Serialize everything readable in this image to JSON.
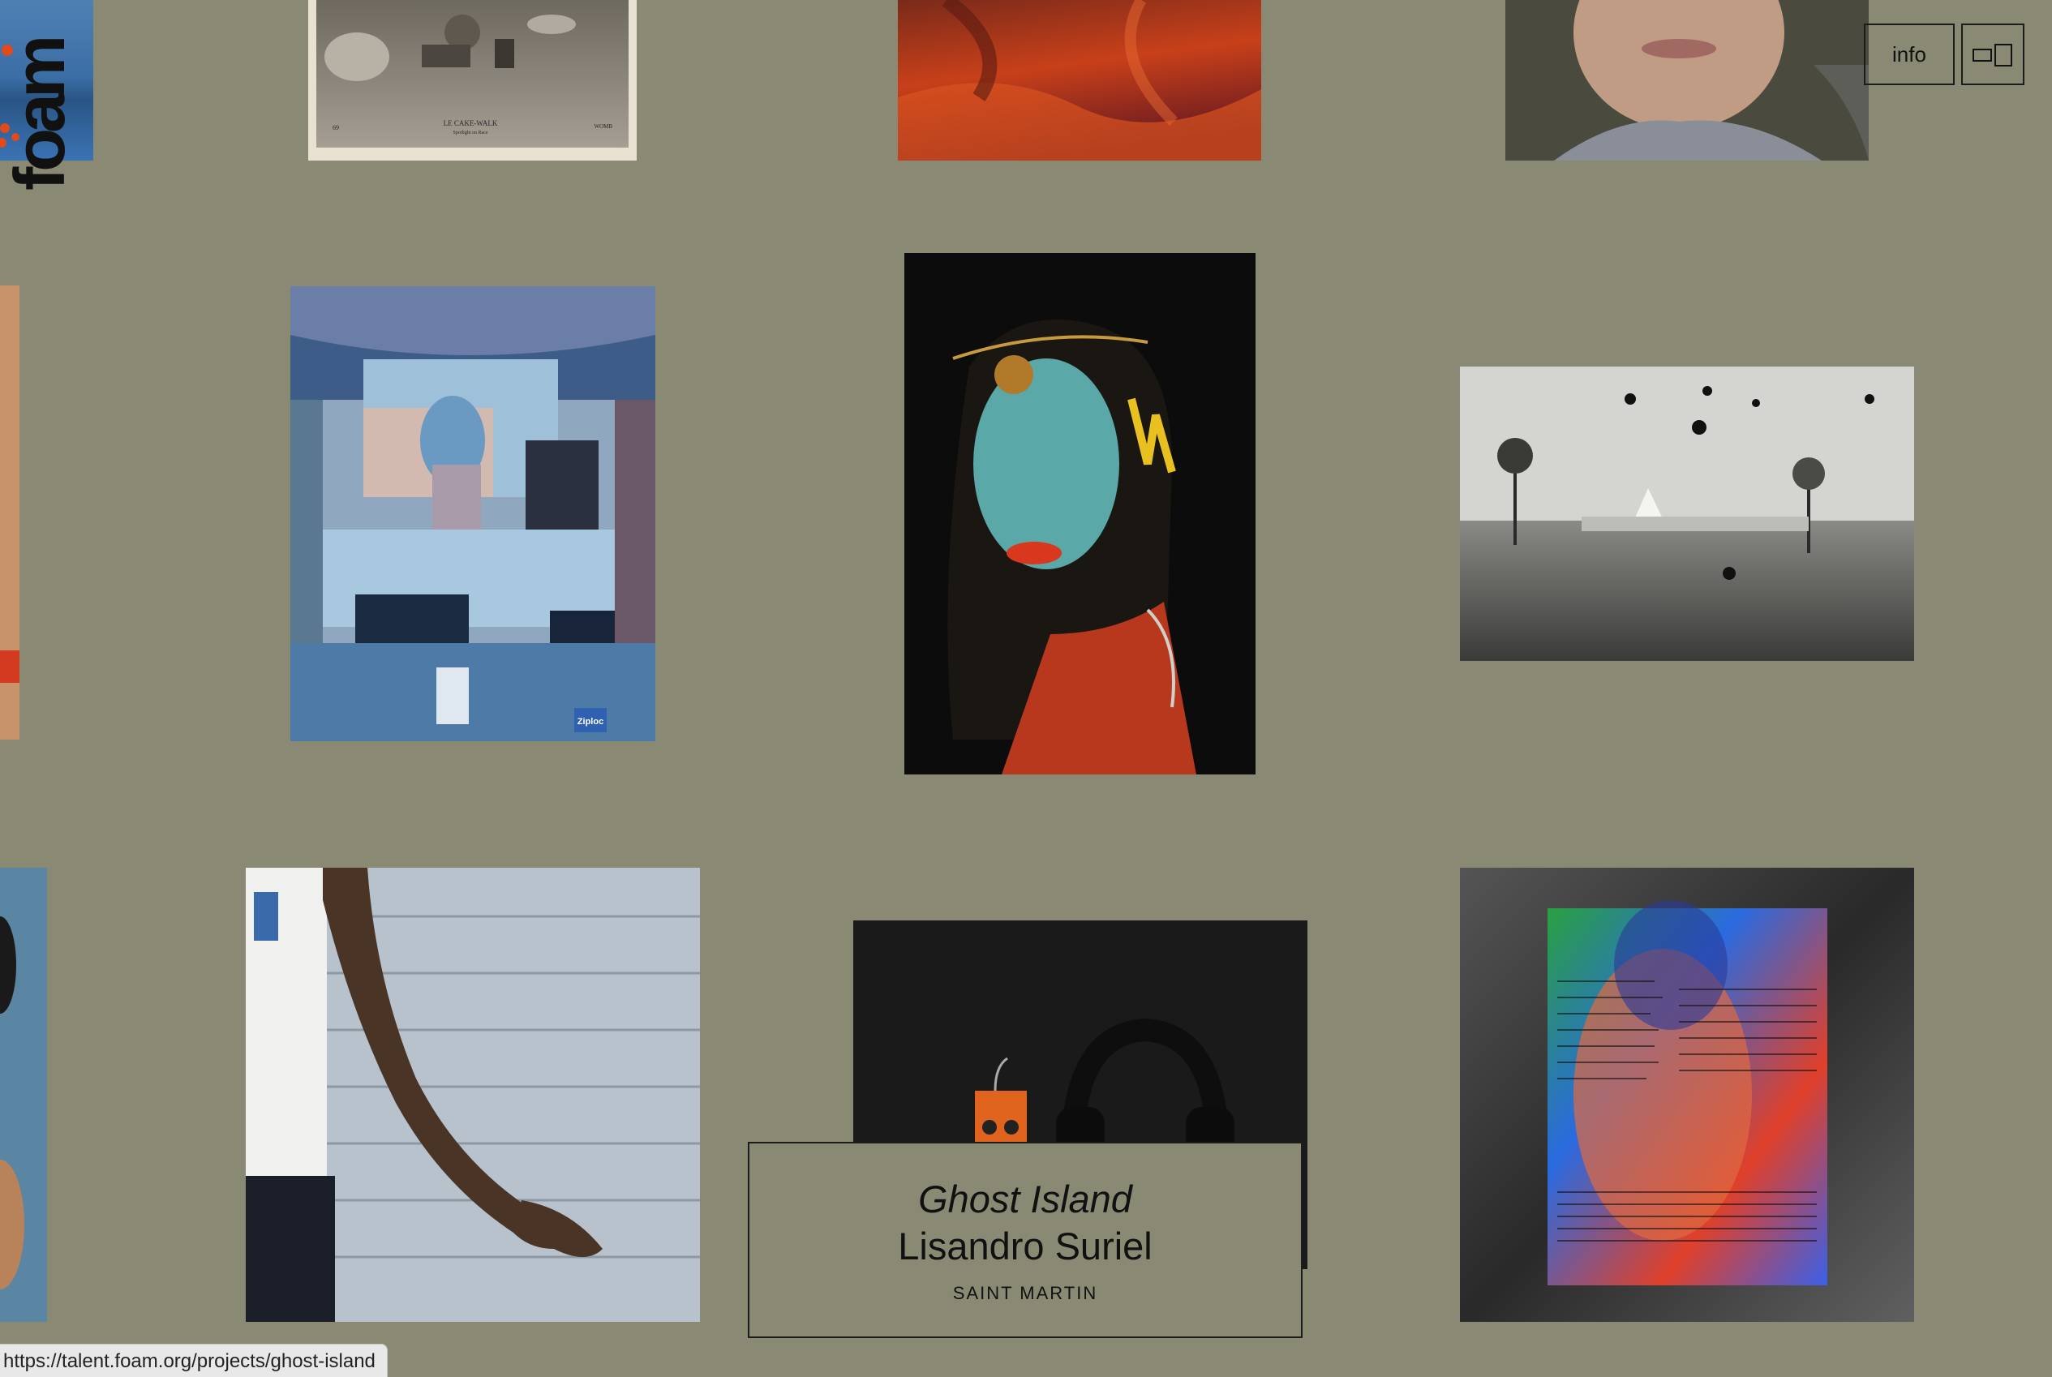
{
  "logo": {
    "text": "foam"
  },
  "controls": {
    "info_label": "info",
    "layout_toggle_icon": "layout-toggle-icon"
  },
  "featured": {
    "title": "Ghost Island",
    "artist": "Lisandro Suriel",
    "location": "SAINT MARTIN"
  },
  "status_bar": {
    "url": "https://talent.foam.org/projects/ghost-island"
  },
  "photos": {
    "cakewalk_poster": {
      "left_text": "69",
      "center_title": "LE CAKE-WALK",
      "center_sub": "Spotlight on Race",
      "right_text": "WOMB"
    },
    "ziploc_label": "Ziploc"
  },
  "colors": {
    "background": "#8a8a74",
    "border": "#1c1c1c",
    "status_bar_bg": "#e8e8e8"
  }
}
